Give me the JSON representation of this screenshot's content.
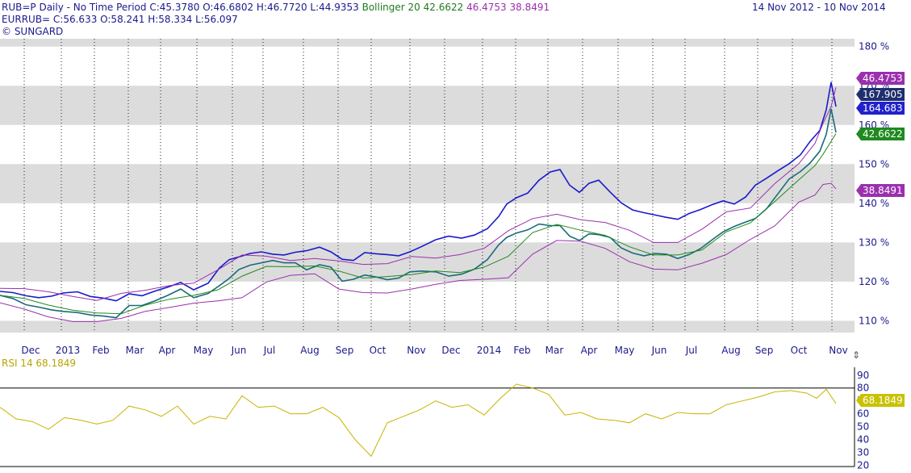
{
  "header": {
    "line1_left": "RUB=P Daily -   No Time Period   C:45.3780 O:46.6802 H:46.7720 L:44.9353",
    "bollinger": "Bollinger 20 42.6622",
    "bollinger_upper": "46.4753",
    "bollinger_lower": "38.8491",
    "date_range": "14 Nov 2012  -  10 Nov 2014",
    "line2": "EURRUB=   C:56.633 O:58.241 H:58.334 L:56.097",
    "line3": "© SUNGARD",
    "rsi": "RSI 14  68.1849"
  },
  "badges": [
    {
      "text": "46.4753",
      "color": "#9b2fae"
    },
    {
      "text": "167.905",
      "color": "#1f2f6e"
    },
    {
      "text": "164.683",
      "color": "#2222cc"
    },
    {
      "text": "42.6622",
      "color": "#1f8a1f"
    },
    {
      "text": "38.8491",
      "color": "#9b2fae"
    },
    {
      "text": "68.1849",
      "color": "#c8c200"
    }
  ],
  "chart_data": {
    "type": "line",
    "x_ticks": [
      "Dec",
      "2013",
      "Feb",
      "Mar",
      "Apr",
      "May",
      "Jun",
      "Jul",
      "Aug",
      "Sep",
      "Oct",
      "Nov",
      "Dec",
      "2014",
      "Feb",
      "Mar",
      "Apr",
      "May",
      "Jun",
      "Jul",
      "Aug",
      "Sep",
      "Oct",
      "Nov"
    ],
    "main_y_ticks": [
      "110 %",
      "120 %",
      "130 %",
      "140 %",
      "150 %",
      "160 %",
      "170 %",
      "180 %"
    ],
    "main_ylim": [
      107,
      182
    ],
    "rsi_y_ticks": [
      "20",
      "30",
      "40",
      "50",
      "60",
      "70",
      "80",
      "90"
    ],
    "rsi_ylim": [
      19,
      93
    ],
    "grid": true,
    "series": [
      {
        "name": "EURRUB=",
        "color": "#1a1acc",
        "x": [
          0,
          16,
          32,
          48,
          64,
          78,
          96,
          112,
          128,
          144,
          160,
          176,
          192,
          208,
          224,
          240,
          258,
          272,
          284,
          296,
          310,
          324,
          338,
          352,
          366,
          380,
          396,
          410,
          424,
          438,
          452,
          466,
          480,
          494,
          508,
          522,
          540,
          556,
          572,
          588,
          604,
          618,
          628,
          640,
          654,
          668,
          682,
          694,
          706,
          718,
          730,
          742,
          756,
          770,
          784,
          798,
          812,
          826,
          840,
          854,
          868,
          882,
          896,
          910,
          924,
          936,
          950,
          964,
          978,
          992,
          1004,
          1016,
          1024,
          1030,
          1036
        ],
        "y": [
          117.5,
          117.2,
          116.4,
          115.9,
          116.3,
          117.1,
          117.4,
          116.2,
          115.8,
          115.1,
          116.9,
          116.4,
          117.6,
          118.6,
          119.8,
          117.9,
          119.6,
          123.5,
          125.6,
          126.3,
          127.2,
          127.6,
          127.0,
          126.8,
          127.5,
          127.9,
          128.8,
          127.6,
          125.7,
          125.4,
          127.4,
          127.1,
          126.9,
          126.6,
          127.6,
          128.9,
          130.7,
          131.6,
          131.1,
          131.9,
          133.5,
          136.6,
          139.8,
          141.4,
          142.6,
          145.9,
          148.0,
          148.6,
          144.6,
          142.8,
          145.1,
          145.9,
          142.9,
          140.1,
          138.3,
          137.6,
          137.0,
          136.4,
          135.9,
          137.4,
          138.4,
          139.6,
          140.6,
          139.8,
          141.6,
          144.6,
          146.4,
          148.3,
          150.1,
          152.4,
          155.8,
          158.6,
          163.9,
          170.9,
          164.7
        ]
      },
      {
        "name": "RUB=P",
        "color": "#1a6a7a",
        "x": [
          0,
          16,
          32,
          48,
          64,
          78,
          96,
          112,
          128,
          144,
          160,
          176,
          192,
          208,
          224,
          240,
          258,
          272,
          284,
          296,
          310,
          324,
          338,
          352,
          366,
          380,
          396,
          410,
          424,
          438,
          452,
          466,
          480,
          494,
          508,
          522,
          540,
          556,
          572,
          588,
          604,
          618,
          628,
          640,
          654,
          668,
          682,
          694,
          706,
          718,
          730,
          742,
          756,
          770,
          784,
          798,
          812,
          826,
          840,
          854,
          868,
          882,
          896,
          910,
          924,
          936,
          950,
          964,
          978,
          992,
          1004,
          1016,
          1024,
          1030,
          1036
        ],
        "y": [
          116.5,
          115.7,
          114.1,
          113.5,
          112.8,
          112.4,
          112.1,
          111.5,
          111.2,
          110.8,
          113.9,
          113.9,
          115.1,
          116.5,
          118.1,
          115.9,
          117.0,
          119.0,
          120.8,
          123.1,
          124.2,
          124.8,
          125.4,
          124.8,
          124.8,
          123.0,
          124.3,
          123.7,
          120.1,
          120.6,
          121.7,
          121.2,
          120.5,
          120.9,
          122.5,
          122.7,
          122.5,
          121.4,
          121.9,
          123.2,
          125.6,
          129.4,
          131.3,
          132.4,
          133.2,
          134.7,
          134.3,
          134.3,
          131.6,
          130.5,
          132.2,
          132.0,
          131.3,
          128.6,
          127.3,
          126.6,
          127.2,
          127.0,
          125.9,
          126.9,
          128.4,
          130.6,
          132.7,
          134.1,
          135.2,
          136.1,
          138.6,
          142.4,
          146.2,
          148.1,
          150.3,
          153.3,
          157.6,
          164.1,
          158.1
        ]
      },
      {
        "name": "Bollinger 20",
        "color": "#1f8a1f",
        "x": [
          0,
          30,
          60,
          90,
          120,
          150,
          180,
          210,
          240,
          270,
          300,
          330,
          360,
          390,
          420,
          450,
          480,
          510,
          540,
          570,
          600,
          630,
          660,
          690,
          720,
          750,
          780,
          810,
          840,
          870,
          900,
          930,
          960,
          990,
          1010,
          1020,
          1036
        ],
        "y": [
          116.5,
          115.7,
          114.0,
          112.7,
          112.0,
          111.8,
          114.0,
          115.5,
          116.5,
          117.9,
          121.4,
          123.9,
          123.8,
          124.0,
          122.7,
          120.9,
          121.3,
          121.8,
          122.7,
          122.3,
          123.7,
          126.5,
          132.5,
          134.6,
          133.1,
          131.8,
          128.9,
          126.8,
          126.8,
          128.1,
          132.7,
          135.0,
          140.4,
          146.0,
          149.6,
          152.5,
          157.8
        ]
      },
      {
        "name": "Bollinger Upper",
        "color": "#9b2fae",
        "x": [
          0,
          30,
          60,
          90,
          120,
          150,
          180,
          210,
          240,
          270,
          300,
          330,
          360,
          390,
          420,
          450,
          480,
          510,
          540,
          570,
          600,
          630,
          660,
          690,
          720,
          750,
          780,
          810,
          840,
          870,
          900,
          930,
          960,
          990,
          1010,
          1020,
          1030,
          1036
        ],
        "y": [
          118.3,
          118.2,
          117.4,
          116.2,
          115.2,
          117.0,
          117.8,
          119.0,
          119.6,
          123.0,
          126.8,
          126.5,
          125.4,
          125.9,
          125.3,
          124.4,
          124.6,
          126.4,
          126.0,
          126.9,
          128.5,
          133.0,
          136.1,
          137.2,
          135.8,
          135.1,
          133.1,
          130.0,
          130.0,
          133.4,
          137.8,
          138.8,
          145.0,
          150.1,
          155.3,
          160.4,
          164.7,
          169.6
        ]
      },
      {
        "name": "Bollinger Lower",
        "color": "#9b2fae",
        "x": [
          0,
          30,
          60,
          90,
          120,
          150,
          180,
          210,
          240,
          270,
          300,
          330,
          360,
          390,
          420,
          450,
          480,
          510,
          540,
          570,
          600,
          630,
          660,
          690,
          720,
          750,
          780,
          810,
          840,
          870,
          900,
          930,
          960,
          990,
          1010,
          1020,
          1030,
          1036
        ],
        "y": [
          114.6,
          113.0,
          111.0,
          109.8,
          109.8,
          110.6,
          112.4,
          113.4,
          114.5,
          115.1,
          115.9,
          119.9,
          121.6,
          122.0,
          118.1,
          117.2,
          117.1,
          118.1,
          119.3,
          120.3,
          120.6,
          121.0,
          127.0,
          130.5,
          130.3,
          128.5,
          125.1,
          123.2,
          123.0,
          124.7,
          126.9,
          130.8,
          134.2,
          140.3,
          142.1,
          144.8,
          145.1,
          143.7
        ]
      },
      {
        "name": "RSI 14",
        "color": "#c8b400",
        "x": [
          0,
          20,
          40,
          60,
          80,
          100,
          120,
          140,
          160,
          180,
          200,
          220,
          240,
          260,
          280,
          300,
          320,
          340,
          360,
          380,
          400,
          420,
          440,
          460,
          480,
          500,
          520,
          540,
          560,
          580,
          600,
          620,
          640,
          660,
          680,
          700,
          720,
          740,
          760,
          780,
          800,
          820,
          840,
          860,
          880,
          900,
          920,
          940,
          960,
          980,
          1000,
          1012,
          1024,
          1036
        ],
        "y": [
          65,
          56,
          54,
          48,
          57,
          55,
          52,
          55,
          66,
          63,
          58,
          66,
          52,
          58,
          56,
          74,
          65,
          66,
          60,
          60,
          65,
          57,
          40,
          27,
          53,
          58,
          63,
          70,
          65,
          67,
          59,
          72,
          83,
          80,
          75,
          59,
          61,
          56,
          55,
          53,
          60,
          56,
          61,
          60,
          60,
          67,
          70,
          73,
          77,
          78,
          76,
          72,
          79,
          68
        ]
      }
    ]
  }
}
